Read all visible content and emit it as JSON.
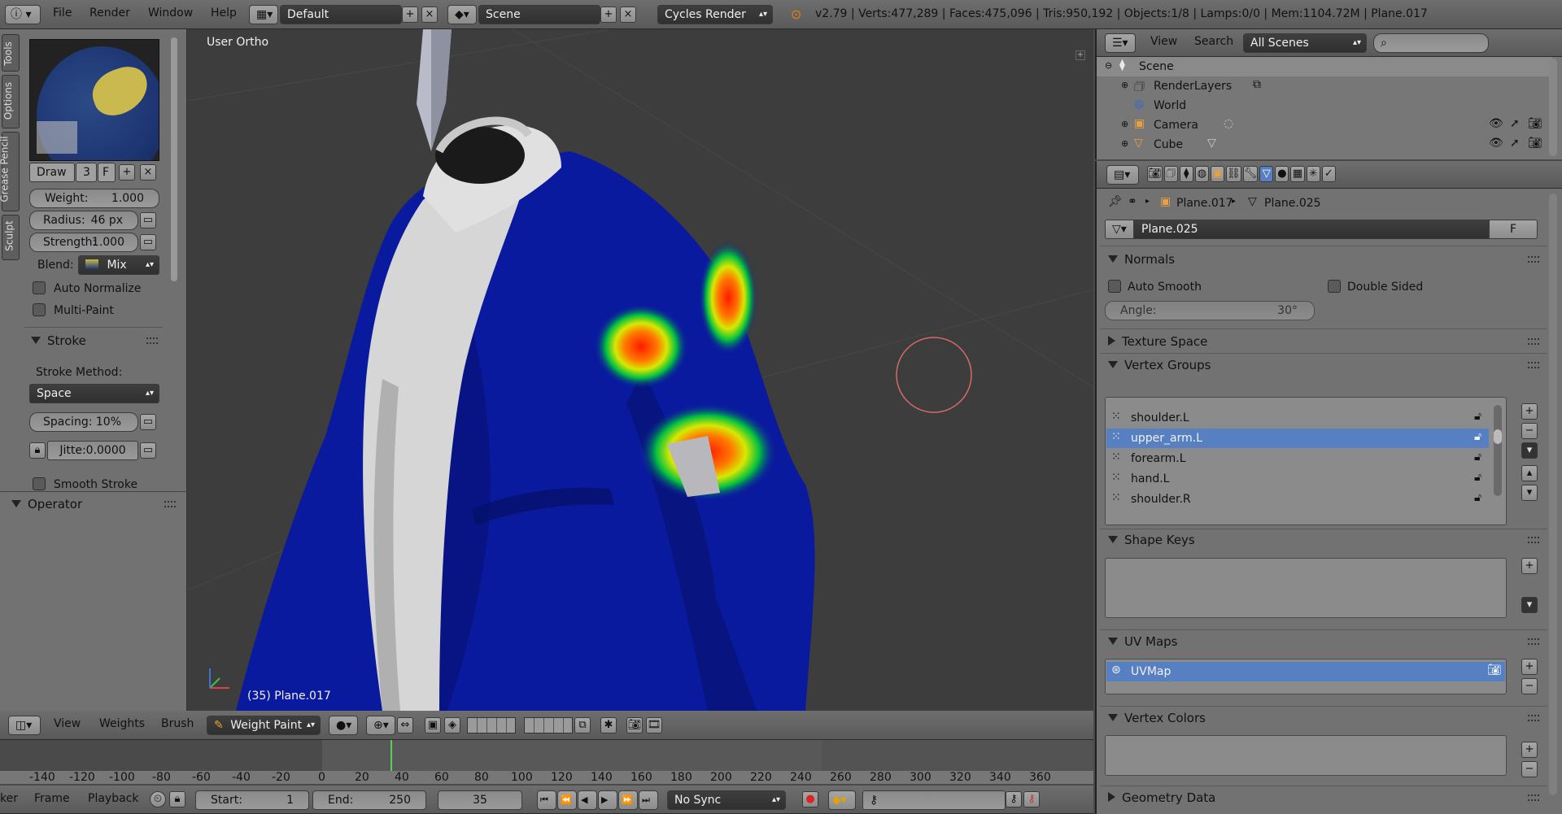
{
  "topbar": {
    "menus": [
      "File",
      "Render",
      "Window",
      "Help"
    ],
    "layout": "Default",
    "scene": "Scene",
    "engine": "Cycles Render",
    "stats": "v2.79 | Verts:477,289 | Faces:475,096 | Tris:950,192 | Objects:1/8 | Lamps:0/0 | Mem:1104.72M | Plane.017"
  },
  "left_tabs": [
    "Tools",
    "Options",
    "Grease Pencil",
    "Sculpt"
  ],
  "tool_panel": {
    "brush_name": "Draw",
    "brush_users": "3",
    "brush_fake": "F",
    "weight_label": "Weight:",
    "weight_value": "1.000",
    "radius_label": "Radius:",
    "radius_value": "46 px",
    "strength_label": "Strength:",
    "strength_value": "1.000",
    "blend_label": "Blend:",
    "blend_value": "Mix",
    "auto_normalize": "Auto Normalize",
    "multi_paint": "Multi-Paint",
    "stroke_section": "Stroke",
    "stroke_method_label": "Stroke Method:",
    "stroke_method_value": "Space",
    "spacing_label": "Spacing:",
    "spacing_value": "10%",
    "jitter_label": "Jitte:",
    "jitter_value": "0.0000",
    "smooth_stroke": "Smooth Stroke",
    "operator_section": "Operator"
  },
  "viewport": {
    "view_label": "User Ortho",
    "object_label": "(35) Plane.017"
  },
  "viewport_header": {
    "menus": [
      "View",
      "Weights",
      "Brush"
    ],
    "mode": "Weight Paint"
  },
  "timeline": {
    "ticks": [
      "-140",
      "-120",
      "-100",
      "-80",
      "-60",
      "-40",
      "-20",
      "0",
      "20",
      "40",
      "60",
      "80",
      "100",
      "120",
      "140",
      "160",
      "180",
      "200",
      "220",
      "240",
      "260",
      "280",
      "300",
      "320",
      "340",
      "360"
    ],
    "menus": [
      "ker",
      "Frame",
      "Playback"
    ],
    "start_label": "Start:",
    "start_value": "1",
    "end_label": "End:",
    "end_value": "250",
    "current_frame": "35",
    "sync": "No Sync"
  },
  "outliner": {
    "menus": [
      "View",
      "Search"
    ],
    "filter": "All Scenes",
    "search_placeholder": "",
    "items": [
      {
        "label": "Scene"
      },
      {
        "label": "RenderLayers"
      },
      {
        "label": "World"
      },
      {
        "label": "Camera"
      },
      {
        "label": "Cube"
      }
    ]
  },
  "properties": {
    "breadcrumb_object": "Plane.017",
    "breadcrumb_mesh": "Plane.025",
    "mesh_name": "Plane.025",
    "mesh_fake": "F",
    "normals_section": "Normals",
    "auto_smooth": "Auto Smooth",
    "double_sided": "Double Sided",
    "angle_label": "Angle:",
    "angle_value": "30°",
    "texture_space_section": "Texture Space",
    "vertex_groups_section": "Vertex Groups",
    "vertex_groups": [
      "shoulder.L",
      "upper_arm.L",
      "forearm.L",
      "hand.L",
      "shoulder.R"
    ],
    "shape_keys_section": "Shape Keys",
    "uv_maps_section": "UV Maps",
    "uv_maps": [
      "UVMap"
    ],
    "vertex_colors_section": "Vertex Colors",
    "geometry_data_section": "Geometry Data"
  },
  "colors": {
    "selection": "#5680c2",
    "viewport_bg": "#3d3d3d",
    "jacket": "#0b1a9c"
  }
}
